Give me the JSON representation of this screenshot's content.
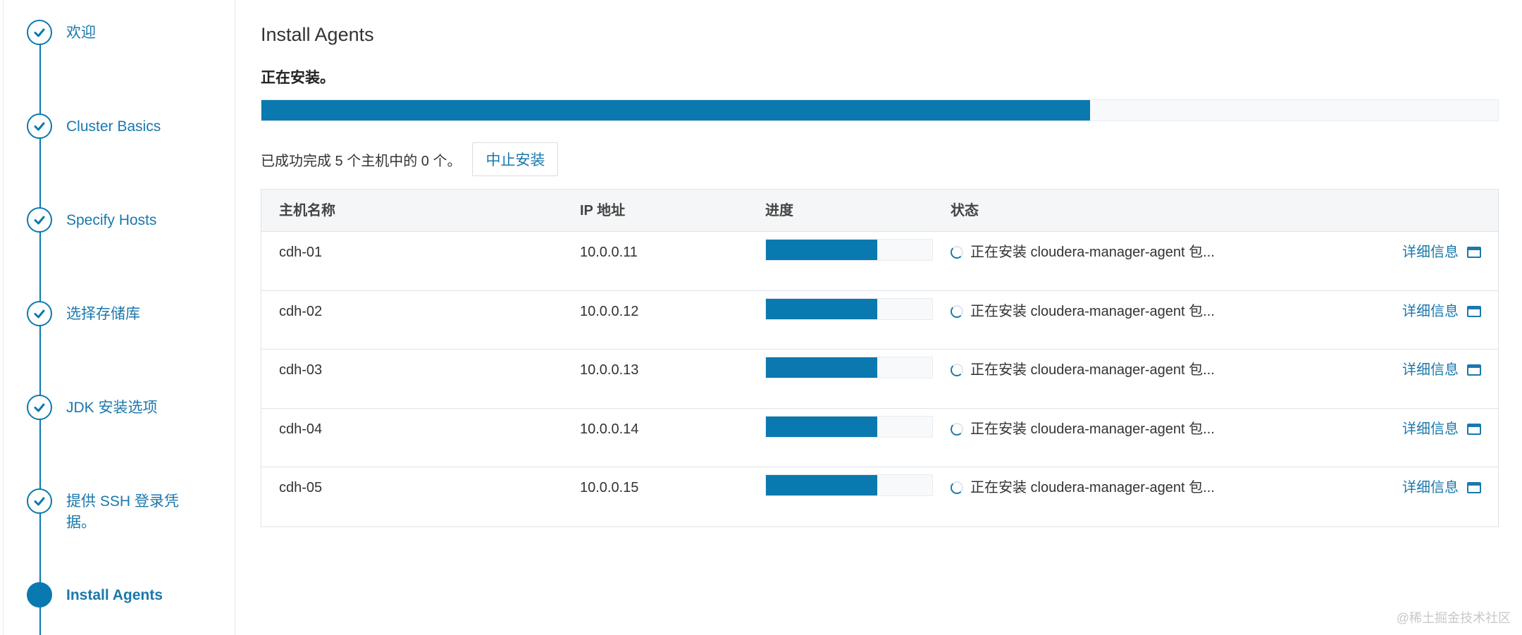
{
  "sidebar": {
    "steps": [
      {
        "label": "欢迎",
        "state": "done"
      },
      {
        "label": "Cluster Basics",
        "state": "done"
      },
      {
        "label": "Specify Hosts",
        "state": "done"
      },
      {
        "label": "选择存储库",
        "state": "done"
      },
      {
        "label": "JDK 安装选项",
        "state": "done"
      },
      {
        "label": "提供 SSH 登录凭据。",
        "state": "done"
      },
      {
        "label": "Install Agents",
        "state": "current"
      }
    ]
  },
  "main": {
    "title": "Install Agents",
    "status": "正在安装。",
    "overall_progress": 0.67,
    "summary": "已成功完成 5 个主机中的 0 个。",
    "abort_label": "中止安装"
  },
  "table": {
    "headers": [
      "主机名称",
      "IP 地址",
      "进度",
      "状态"
    ],
    "rows": [
      {
        "host": "cdh-01",
        "ip": "10.0.0.11",
        "progress": 0.67,
        "status": "正在安装 cloudera-manager-agent 包...",
        "detail": "详细信息"
      },
      {
        "host": "cdh-02",
        "ip": "10.0.0.12",
        "progress": 0.67,
        "status": "正在安装 cloudera-manager-agent 包...",
        "detail": "详细信息"
      },
      {
        "host": "cdh-03",
        "ip": "10.0.0.13",
        "progress": 0.67,
        "status": "正在安装 cloudera-manager-agent 包...",
        "detail": "详细信息"
      },
      {
        "host": "cdh-04",
        "ip": "10.0.0.14",
        "progress": 0.67,
        "status": "正在安装 cloudera-manager-agent 包...",
        "detail": "详细信息"
      },
      {
        "host": "cdh-05",
        "ip": "10.0.0.15",
        "progress": 0.67,
        "status": "正在安装 cloudera-manager-agent 包...",
        "detail": "详细信息"
      }
    ]
  },
  "watermark": "@稀土掘金技术社区",
  "colors": {
    "accent": "#0a79b0",
    "link": "#1a78ac"
  }
}
